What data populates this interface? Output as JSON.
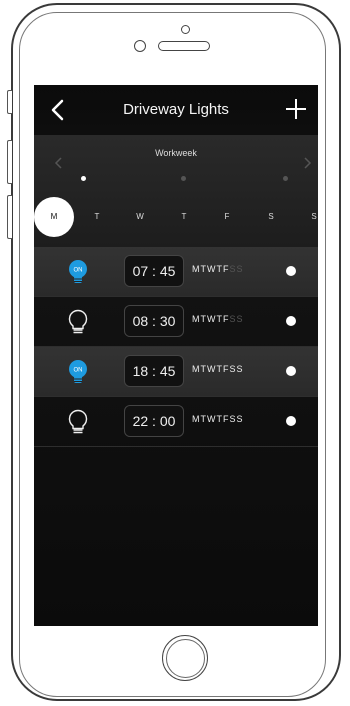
{
  "header": {
    "title": "Driveway Lights"
  },
  "week": {
    "label": "Workweek"
  },
  "days": [
    "M",
    "T",
    "W",
    "T",
    "F",
    "S",
    "S"
  ],
  "schedules": [
    {
      "time": "07 : 45",
      "on": true,
      "days": [
        {
          "d": "M",
          "active": true
        },
        {
          "d": "T",
          "active": true
        },
        {
          "d": "W",
          "active": true
        },
        {
          "d": "T",
          "active": true
        },
        {
          "d": "F",
          "active": true
        },
        {
          "d": "S",
          "active": false
        },
        {
          "d": "S",
          "active": false
        }
      ]
    },
    {
      "time": "08 : 30",
      "on": false,
      "days": [
        {
          "d": "M",
          "active": true
        },
        {
          "d": "T",
          "active": true
        },
        {
          "d": "W",
          "active": true
        },
        {
          "d": "T",
          "active": true
        },
        {
          "d": "F",
          "active": true
        },
        {
          "d": "S",
          "active": false
        },
        {
          "d": "S",
          "active": false
        }
      ]
    },
    {
      "time": "18 : 45",
      "on": true,
      "days": [
        {
          "d": "M",
          "active": true
        },
        {
          "d": "T",
          "active": true
        },
        {
          "d": "W",
          "active": true
        },
        {
          "d": "T",
          "active": true
        },
        {
          "d": "F",
          "active": true
        },
        {
          "d": "S",
          "active": true
        },
        {
          "d": "S",
          "active": true
        }
      ]
    },
    {
      "time": "22 : 00",
      "on": false,
      "days": [
        {
          "d": "M",
          "active": true
        },
        {
          "d": "T",
          "active": true
        },
        {
          "d": "W",
          "active": true
        },
        {
          "d": "T",
          "active": true
        },
        {
          "d": "F",
          "active": true
        },
        {
          "d": "S",
          "active": true
        },
        {
          "d": "S",
          "active": true
        }
      ]
    }
  ],
  "bulb_on_label": "ON",
  "colors": {
    "accent": "#1e9be0",
    "inactive_day": "#555555"
  },
  "icons": {
    "back": "chevron-left-icon",
    "add": "plus-icon",
    "bulb_on": "bulb-on-icon",
    "bulb_off": "bulb-outline-icon"
  }
}
